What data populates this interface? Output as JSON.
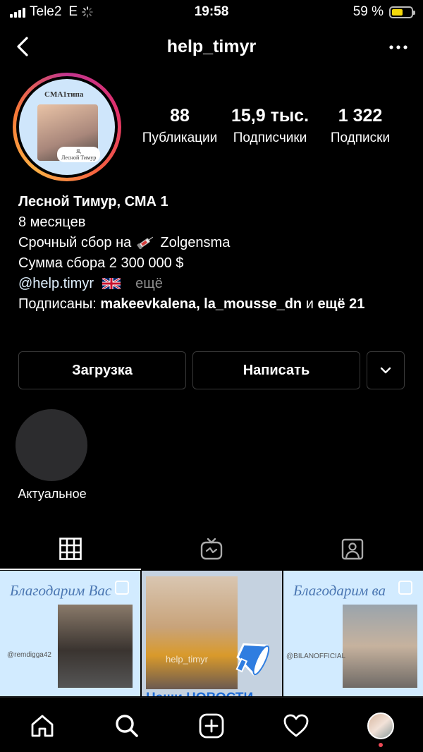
{
  "status_bar": {
    "carrier": "Tele2",
    "network": "E",
    "time": "19:58",
    "battery": "59 %",
    "battery_level": 0.59
  },
  "header": {
    "username": "help_timyr"
  },
  "profile": {
    "avatar_caption": "СМА1типа",
    "avatar_note_line1": "Я,",
    "avatar_note_line2": "Лесной Тимур",
    "stats": [
      {
        "value": "88",
        "label": "Публикации"
      },
      {
        "value": "15,9 тыс.",
        "label": "Подписчики"
      },
      {
        "value": "1 322",
        "label": "Подписки"
      }
    ],
    "bio": {
      "name": "Лесной Тимур, СМА 1",
      "line1": "8 месяцев",
      "line2_prefix": "Срочный сбор на",
      "line2_suffix": "Zolgensma",
      "line3": "Сумма сбора 2 300 000 $",
      "link": "@help.timyr",
      "more": "ещё",
      "followed_prefix": "Подписаны:",
      "followed_names": "makeevkalena, la_mousse_dn",
      "followed_and": "и",
      "followed_more": "ещё 21"
    }
  },
  "buttons": {
    "load": "Загрузка",
    "write": "Написать"
  },
  "highlights": {
    "label": "Актуальное"
  },
  "tabs": {
    "active": "grid"
  },
  "posts": [
    {
      "title": "Благодарим Вас",
      "handle": "@remdigga42"
    },
    {
      "watermark": "help_timyr",
      "banner": "Наши НОВОСТИ"
    },
    {
      "title": "Благодарим ва",
      "handle": "@BILANOFFICIAL"
    }
  ],
  "colors": {
    "accent_link": "#e0f1ff",
    "notification_dot": "#ed4956",
    "post_bg": "#d2ebff"
  }
}
